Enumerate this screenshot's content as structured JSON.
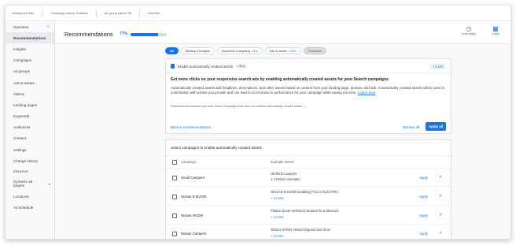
{
  "filter_bar": {
    "workspace": "Workspace filter",
    "campaign_status": "Campaign status: Enabled",
    "ad_group_status": "Ad group status: All",
    "add_filter": "Add filter"
  },
  "sidebar": {
    "items": [
      {
        "label": "Overview",
        "icon": "home-icon"
      },
      {
        "label": "Recommendations"
      },
      {
        "label": "Insights"
      },
      {
        "label": "Campaigns"
      },
      {
        "label": "Ad groups"
      },
      {
        "label": "Ads & assets"
      },
      {
        "label": "Videos"
      },
      {
        "label": "Landing pages"
      },
      {
        "label": "Keywords"
      },
      {
        "label": "Audiences"
      },
      {
        "label": "Content"
      },
      {
        "label": "Settings"
      },
      {
        "label": "Change history"
      }
    ],
    "show_less": "Show less",
    "dynamic_ad_targets": "Dynamic ad targets",
    "locations": "Locations",
    "ad_schedule": "Ad schedule"
  },
  "header": {
    "title": "Recommendations",
    "optimization_score": "77%",
    "optimization_fraction": 0.77,
    "auto_apply_label": "Auto apply",
    "cards_label": "Cards"
  },
  "tabs": [
    {
      "label": "All",
      "count": ""
    },
    {
      "label": "Bidding & budgets",
      "count": ""
    },
    {
      "label": "Keywords & targeting",
      "count": "+4%"
    },
    {
      "label": "Ads & assets",
      "count": "+14%"
    },
    {
      "label": "Dismissed",
      "count": ""
    }
  ],
  "recommendation": {
    "title": "Enable automatically created assets",
    "badge": "(8%)",
    "lift": "+1.1%",
    "headline": "Get more clicks on your responsive search ads by enabling automatically created assets for your Search campaigns",
    "body": "Automatically created assets add headlines, descriptions, and other assets based on content from your landing page, domain, and ads. Automatically created assets will be used in combination with assets you provide and can lead to an increase in performance for your campaign while saving you time.",
    "learn_more": "Learn more",
    "reason": "Recommended because you have Search campaigns that have not enabled automatically created assets ⓘ",
    "back": "Back to recommendations",
    "dismiss_all": "Dismiss all",
    "apply_all": "Apply all"
  },
  "campaigns_table": {
    "heading": "Select campaigns to enable automatically created assets",
    "col_campaign": "Campaign",
    "col_examples": "Example assets",
    "apply_label": "Apply",
    "rows": [
      {
        "name": "Small Campers",
        "ex1": "Hertford Campers",
        "ex2": "1.4 Petrol Automatic",
        "more": false
      },
      {
        "name": "Nissan E-NV200",
        "ex1": "NISSAN E-NV200 enabling FULLY ELECTRIC",
        "ex2": "+ 3 more",
        "more": true
      },
      {
        "name": "Nissan NV200",
        "ex1": "Please Quote Hertford Campers for a discount",
        "ex2": "+ 2 more",
        "more": true
      },
      {
        "name": "Nissan Campers",
        "ex1": "Nissan NV200, Nissan Elgrand and more",
        "ex2": "+ 2 more",
        "more": true
      }
    ]
  },
  "colors": {
    "accent": "#1a73e8",
    "active_nav": "#e8eaed"
  }
}
